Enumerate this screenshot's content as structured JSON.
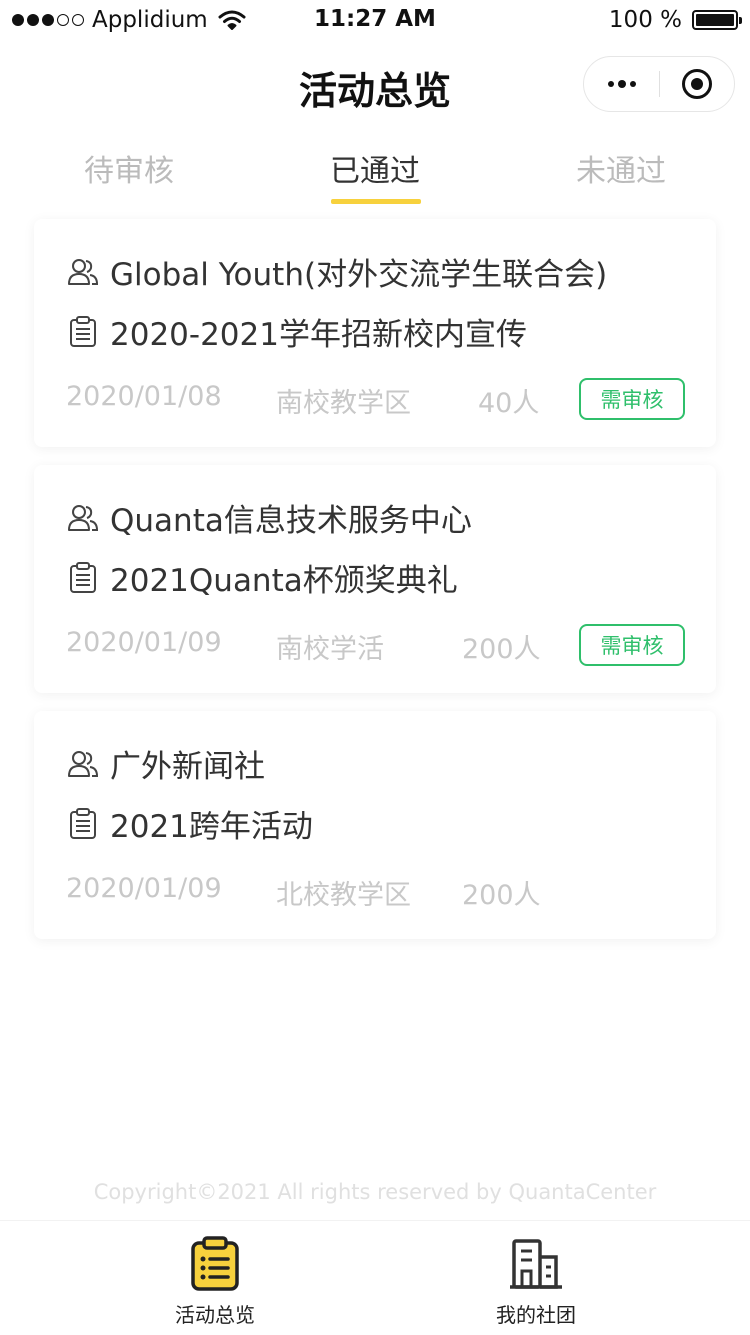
{
  "status_bar": {
    "carrier": "Applidium",
    "time": "11:27 AM",
    "battery": "100 %"
  },
  "nav": {
    "title": "活动总览"
  },
  "tabs": [
    {
      "label": "待审核"
    },
    {
      "label": "已通过"
    },
    {
      "label": "未通过"
    }
  ],
  "activities": [
    {
      "club": "Global Youth(对外交流学生联合会)",
      "title": "2020-2021学年招新校内宣传",
      "date": "2020/01/08",
      "place": "南校教学区",
      "count": "40人",
      "badge": "需审核"
    },
    {
      "club": "Quanta信息技术服务中心",
      "title": "2021Quanta杯颁奖典礼",
      "date": "2020/01/09",
      "place": "南校学活",
      "count": "200人",
      "badge": "需审核"
    },
    {
      "club": "广外新闻社",
      "title": "2021跨年活动",
      "date": "2020/01/09",
      "place": "北校教学区",
      "count": "200人"
    }
  ],
  "footer": {
    "copyright": "Copyright©2021 All rights reserved by QuantaCenter"
  },
  "tabbar": [
    {
      "label": "活动总览",
      "icon": "clipboard-list-icon",
      "color": "#f7d13d"
    },
    {
      "label": "我的社团",
      "icon": "building-icon"
    }
  ],
  "colors": {
    "accent": "#f7d13d",
    "badge": "#2fbf6b",
    "muted": "#c8c8c8"
  }
}
